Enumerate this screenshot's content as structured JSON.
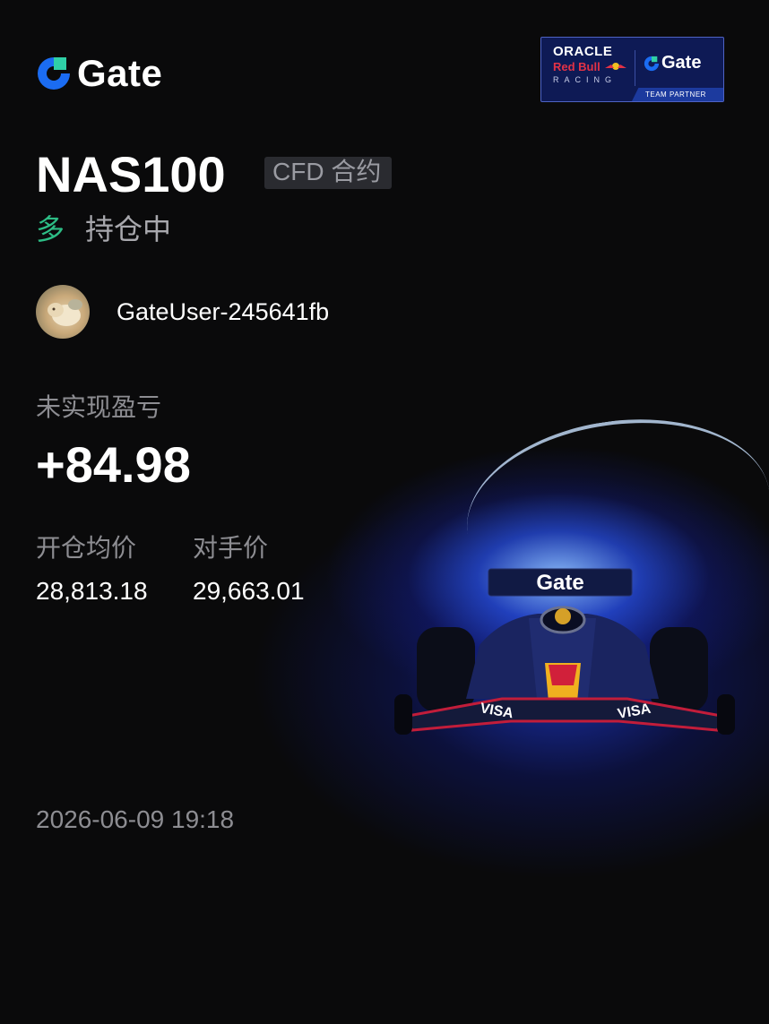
{
  "brand": {
    "name": "Gate",
    "accent_color": "#1b6cf2"
  },
  "sponsor_badge": {
    "line1": "ORACLE",
    "line2": "Red Bull",
    "line3": "RACING",
    "partner_brand": "Gate",
    "partner_caption": "TEAM PARTNER"
  },
  "position": {
    "symbol": "NAS100",
    "contract_tag": "CFD 合约",
    "direction": "多",
    "direction_color": "#2dbd85",
    "status": "持仓中"
  },
  "user": {
    "name": "GateUser-245641fb",
    "avatar_icon": "avatar-photo"
  },
  "pnl": {
    "label": "未实现盈亏",
    "value": "+84.98"
  },
  "prices": {
    "entry_label": "开仓均价",
    "entry_value": "28,813.18",
    "mark_label": "对手价",
    "mark_value": "29,663.01"
  },
  "timestamp": "2026-06-09 19:18",
  "hero": {
    "car_wing_text": "Gate",
    "car_side_text": "VISA"
  }
}
